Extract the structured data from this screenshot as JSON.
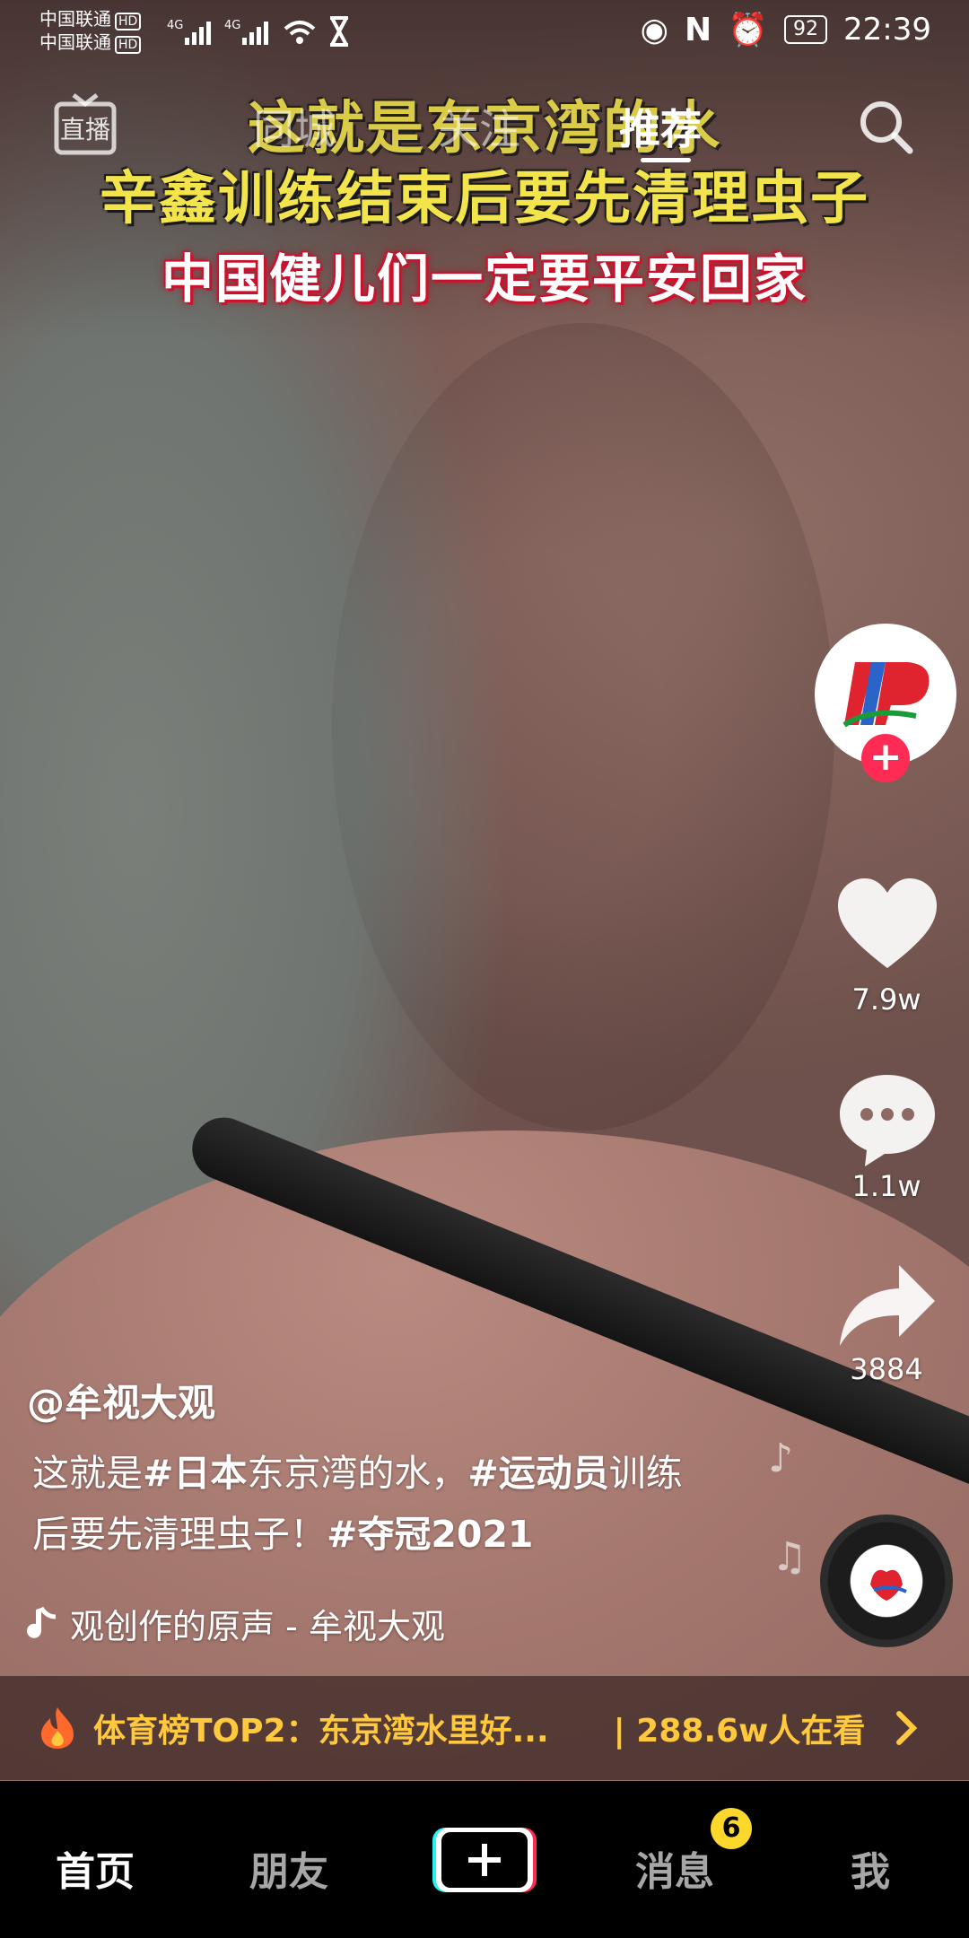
{
  "status_bar": {
    "carrier1": "中国联通",
    "carrier2": "中国联通",
    "hd": "HD",
    "net": "4G",
    "battery": "92",
    "time": "22:39"
  },
  "top_nav": {
    "live_label": "直播",
    "tabs": [
      {
        "label": "同城"
      },
      {
        "label": "关注"
      },
      {
        "label": "推荐"
      }
    ]
  },
  "video": {
    "caption_lines": [
      "这就是东京湾的水",
      "辛鑫训练结束后要先清理虫子",
      "中国健儿们一定要平安回家"
    ]
  },
  "rail": {
    "like_count": "7.9w",
    "comment_count": "1.1w",
    "share_count": "3884",
    "follow_symbol": "+"
  },
  "post": {
    "author": "@牟视大观",
    "desc_parts": [
      "这就是",
      "#日本",
      "东京湾的水，",
      "#运动员",
      "训练后要先清理虫子！",
      "#夺冠2021"
    ],
    "music": "观创作的原声 - 牟视大观"
  },
  "banner": {
    "text": "体育榜TOP2：东京湾水里好...",
    "viewers": "| 288.6w人在看"
  },
  "bottom_nav": {
    "items": [
      "首页",
      "朋友",
      "消息",
      "我"
    ],
    "badge": "6"
  },
  "colors": {
    "accent_red": "#fe2c55",
    "banner_text": "#ffc83d",
    "badge_yellow": "#fcd72c"
  }
}
